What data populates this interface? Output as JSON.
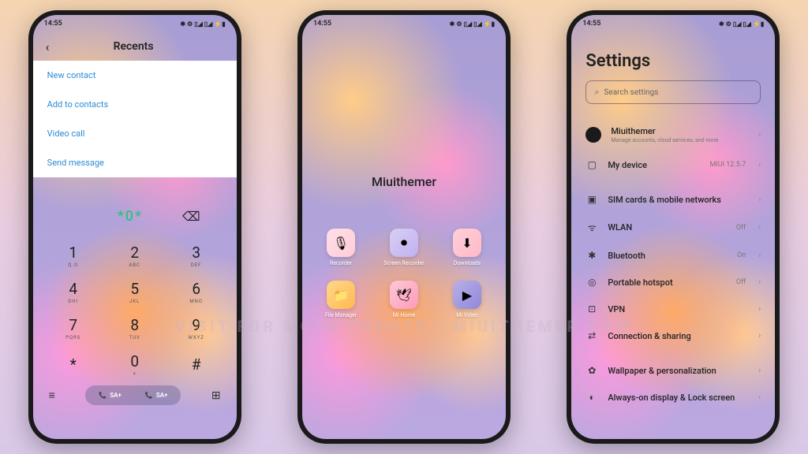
{
  "status": {
    "time": "14:55",
    "icons": "✱ ⚙ ▯◢ ▯◢ ⚡▮"
  },
  "phone1": {
    "header": {
      "title": "Recents"
    },
    "actions": [
      "New contact",
      "Add to contacts",
      "Video call",
      "Send message"
    ],
    "dial": {
      "number": "*0*"
    },
    "keys": [
      {
        "d": "1",
        "l": "Q.O"
      },
      {
        "d": "2",
        "l": "ABC"
      },
      {
        "d": "3",
        "l": "DEF"
      },
      {
        "d": "4",
        "l": "GHI"
      },
      {
        "d": "5",
        "l": "JKL"
      },
      {
        "d": "6",
        "l": "MNO"
      },
      {
        "d": "7",
        "l": "PQRS"
      },
      {
        "d": "8",
        "l": "TUV"
      },
      {
        "d": "9",
        "l": "WXYZ"
      },
      {
        "d": "*",
        "l": ""
      },
      {
        "d": "0",
        "l": "+"
      },
      {
        "d": "#",
        "l": ""
      }
    ],
    "sim": {
      "a": "SA+",
      "b": "SA+"
    }
  },
  "phone2": {
    "title": "Miuithemer",
    "apps": [
      {
        "name": "Recorder",
        "cls": "app-recorder",
        "glyph": "🎙"
      },
      {
        "name": "Screen Recorder",
        "cls": "app-screenrec",
        "glyph": "⏺"
      },
      {
        "name": "Downloads",
        "cls": "app-downloads",
        "glyph": "⬇"
      },
      {
        "name": "File Manager",
        "cls": "app-filemgr",
        "glyph": "📁"
      },
      {
        "name": "Mi Home",
        "cls": "app-mihome",
        "glyph": "🕊"
      },
      {
        "name": "Mi Video",
        "cls": "app-mivideo",
        "glyph": "▶"
      }
    ]
  },
  "phone3": {
    "title": "Settings",
    "search_placeholder": "Search settings",
    "account": {
      "name": "Miuithemer",
      "sub": "Manage accounts, cloud services, and more"
    },
    "items": [
      {
        "icon": "▢",
        "label": "My device",
        "value": "MIUI 12.5.7",
        "gap": true
      },
      {
        "icon": "▣",
        "label": "SIM cards & mobile networks",
        "value": ""
      },
      {
        "icon": "ᯤ",
        "label": "WLAN",
        "value": "Off"
      },
      {
        "icon": "✱",
        "label": "Bluetooth",
        "value": "On"
      },
      {
        "icon": "◎",
        "label": "Portable hotspot",
        "value": "Off"
      },
      {
        "icon": "⊡",
        "label": "VPN",
        "value": ""
      },
      {
        "icon": "⇄",
        "label": "Connection & sharing",
        "value": "",
        "gap": true
      },
      {
        "icon": "✿",
        "label": "Wallpaper & personalization",
        "value": ""
      },
      {
        "icon": "◐",
        "label": "Always-on display & Lock screen",
        "value": ""
      }
    ]
  },
  "watermark": "VISIT FOR MORE THEMES - MIUITHEMER.COM"
}
